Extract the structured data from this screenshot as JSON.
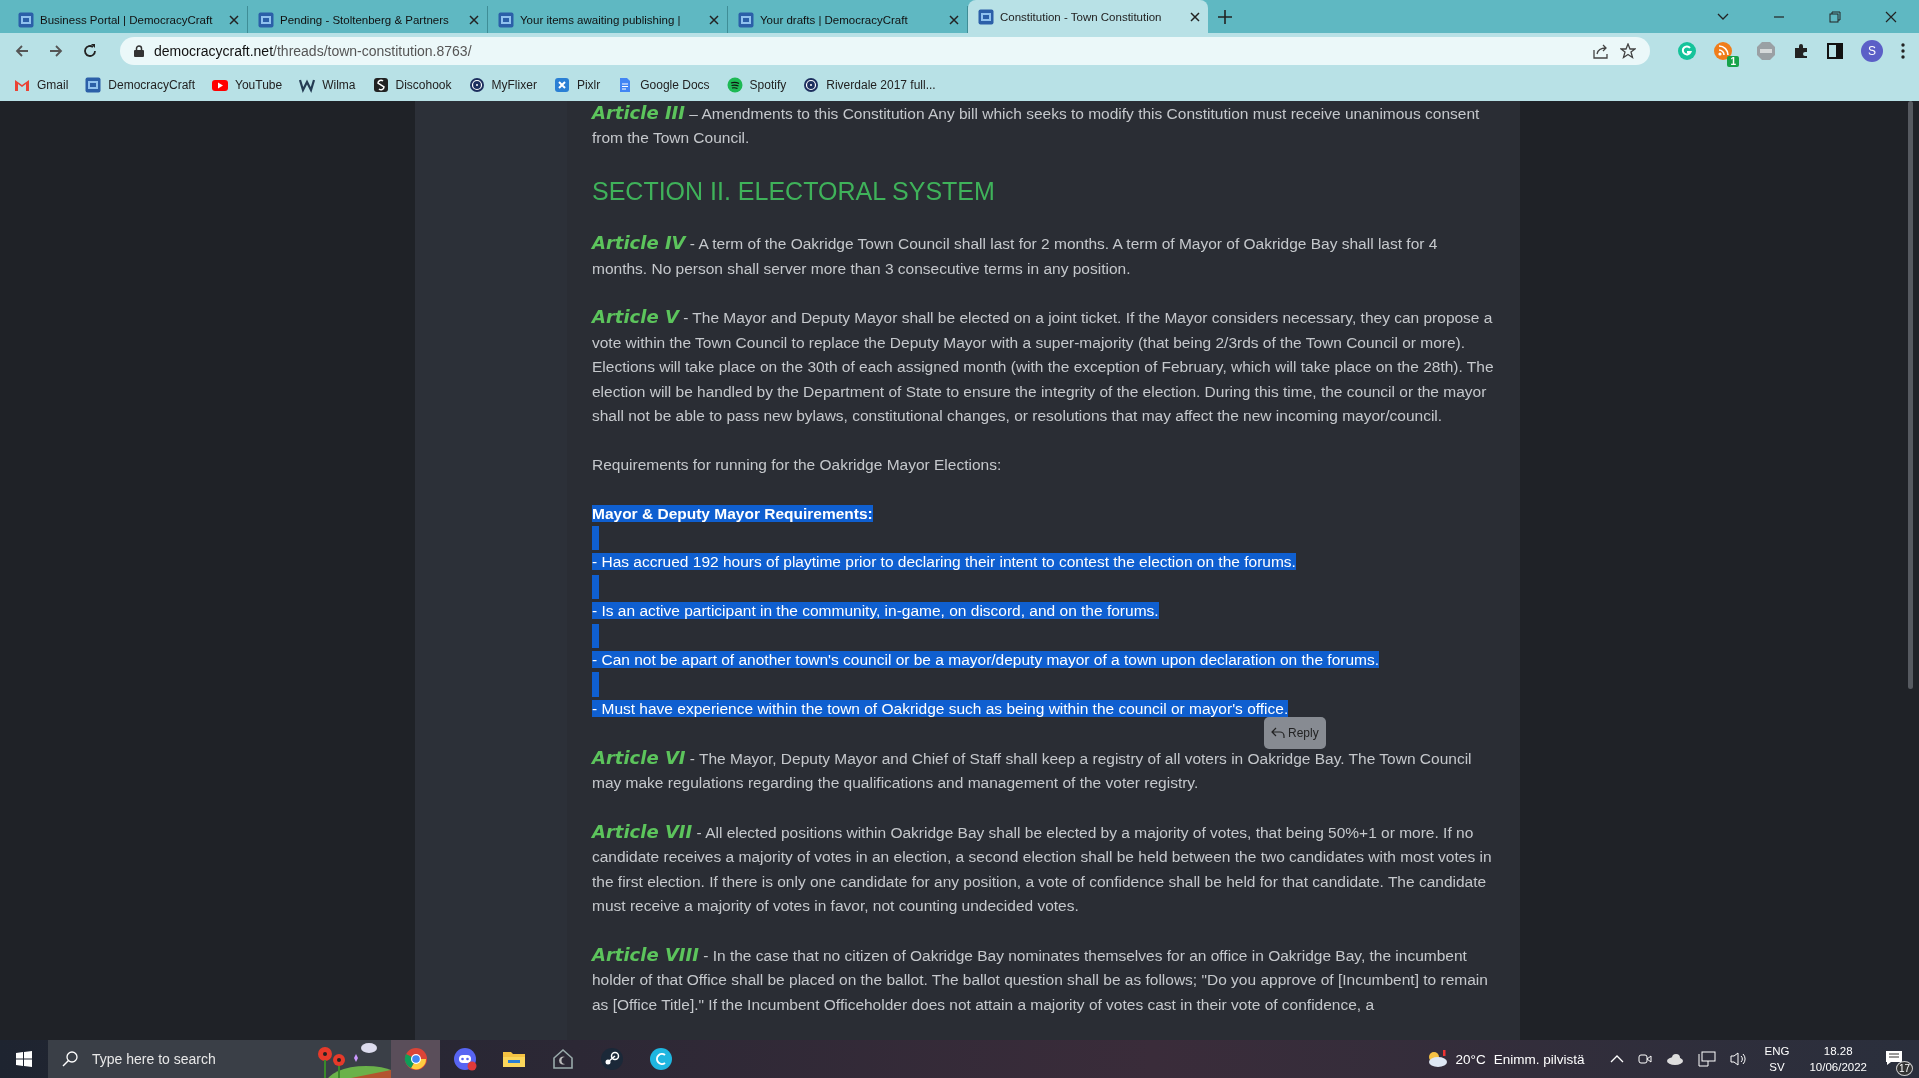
{
  "tabs": [
    {
      "title": "Business Portal | DemocracyCraft",
      "selected": false
    },
    {
      "title": "Pending - Stoltenberg & Partners",
      "selected": false
    },
    {
      "title": "Your items awaiting publishing |",
      "selected": false
    },
    {
      "title": "Your drafts | DemocracyCraft",
      "selected": false
    },
    {
      "title": "Constitution - Town Constitution",
      "selected": true
    }
  ],
  "address_bar": {
    "host": "democracycraft.net",
    "path": "/threads/town-constitution.8763/"
  },
  "extensions": {
    "badge": "1",
    "profile_initial": "S"
  },
  "bookmarks": [
    {
      "label": "Gmail",
      "kind": "gmail"
    },
    {
      "label": "DemocracyCraft",
      "kind": "dc"
    },
    {
      "label": "YouTube",
      "kind": "youtube"
    },
    {
      "label": "Wilma",
      "kind": "wilma"
    },
    {
      "label": "Discohook",
      "kind": "discohook"
    },
    {
      "label": "MyFlixer",
      "kind": "film"
    },
    {
      "label": "Pixlr",
      "kind": "pixlr"
    },
    {
      "label": "Google Docs",
      "kind": "docs"
    },
    {
      "label": "Spotify",
      "kind": "spotify"
    },
    {
      "label": "Riverdale 2017 full...",
      "kind": "film"
    }
  ],
  "post": [
    {
      "kind": "article",
      "label": "Article III",
      "text": " – Amendments to this Constitution Any bill which seeks to modify this Constitution must receive unanimous consent from the Town Council.",
      "selected": false
    },
    {
      "kind": "heading",
      "text": "SECTION II. ELECTORAL SYSTEM",
      "selected": false
    },
    {
      "kind": "article",
      "label": "Article IV",
      "text": " - A term of the Oakridge Town Council shall last for 2 months. A term of Mayor of Oakridge Bay shall last for 4 months. No person shall server more than 3 consecutive terms in any position.",
      "selected": false
    },
    {
      "kind": "article",
      "label": "Article V",
      "text": " - The Mayor and Deputy Mayor shall be elected on a joint ticket. If the Mayor considers necessary, they can propose a vote within the Town Council to replace the Deputy Mayor with a super-majority (that being 2/3rds of the Town Council or more). Elections will take place on the 30th of each assigned month (with the exception of February, which will take place on the 28th). The election will be handled by the Department of State to ensure the integrity of the election. During this time, the council or the mayor shall not be able to pass new bylaws, constitutional changes, or resolutions that may affect the new incoming mayor/council.",
      "selected": false
    },
    {
      "kind": "plain",
      "text": "Requirements for running for the Oakridge Mayor Elections:",
      "selected": false
    },
    {
      "kind": "bold",
      "text": "Mayor & Deputy Mayor Requirements:",
      "selected": true
    },
    {
      "kind": "plain",
      "text": "- Has accrued 192 hours of playtime prior to declaring their intent to contest the election on the forums.",
      "selected": true
    },
    {
      "kind": "plain",
      "text": "- Is an active participant in the community, in-game, on discord, and on the forums.",
      "selected": true
    },
    {
      "kind": "plain",
      "text": "- Can not be apart of another town's council or be a mayor/deputy mayor of a town upon declaration on the forums.",
      "selected": true
    },
    {
      "kind": "plain",
      "text": "- Must have experience within the town of Oakridge such as being within the council or mayor's office.",
      "selected": true,
      "popup": "Reply"
    },
    {
      "kind": "article",
      "label": "Article VI",
      "text": " - The Mayor, Deputy Mayor and Chief of Staff shall keep a registry of all voters in Oakridge Bay. The Town Council may make regulations regarding the qualifications and management of the voter registry.",
      "selected": false
    },
    {
      "kind": "article",
      "label": "Article VII",
      "text": " - All elected positions within Oakridge Bay shall be elected by a majority of votes, that being 50%+1 or more. If no candidate receives a majority of votes in an election, a second election shall be held between the two candidates with most votes in the first election. If there is only one candidate for any position, a vote of confidence shall be held for that candidate. The candidate must receive a majority of votes in favor, not counting undecided votes.",
      "selected": false
    },
    {
      "kind": "article",
      "label": "Article VIII",
      "text": " - In the case that no citizen of Oakridge Bay nominates themselves for an office in Oakridge Bay, the incumbent holder of that Office shall be placed on the ballot. The ballot question shall be as follows; \"Do you approve of [Incumbent] to remain as [Office Title].\" If the Incumbent Officeholder does not attain a majority of votes cast in their vote of confidence, a",
      "selected": false
    }
  ],
  "taskbar": {
    "search_placeholder": "Type here to search",
    "temperature": "20°C",
    "weather": "Enimm. pilvistä",
    "language": "ENG",
    "layout": "SV",
    "time": "18.28",
    "date": "10/06/2022",
    "notifications": "17"
  }
}
